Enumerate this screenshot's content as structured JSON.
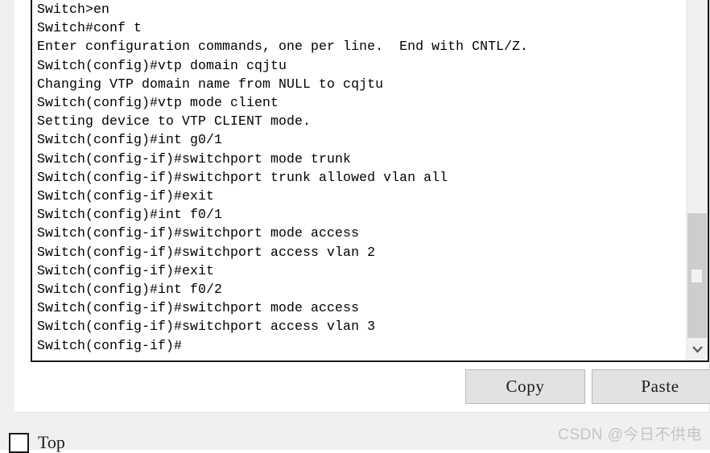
{
  "console": {
    "lines": [
      "Switch>en",
      "Switch#conf t",
      "Enter configuration commands, one per line.  End with CNTL/Z.",
      "Switch(config)#vtp domain cqjtu",
      "Changing VTP domain name from NULL to cqjtu",
      "Switch(config)#vtp mode client",
      "Setting device to VTP CLIENT mode.",
      "Switch(config)#int g0/1",
      "Switch(config-if)#switchport mode trunk",
      "Switch(config-if)#switchport trunk allowed vlan all",
      "Switch(config-if)#exit",
      "Switch(config)#int f0/1",
      "Switch(config-if)#switchport mode access",
      "Switch(config-if)#switchport access vlan 2",
      "Switch(config-if)#exit",
      "Switch(config)#int f0/2",
      "Switch(config-if)#switchport mode access",
      "Switch(config-if)#switchport access vlan 3",
      "Switch(config-if)#"
    ],
    "text_color": "#000000",
    "background_color": "#ffffff"
  },
  "scrollbar": {
    "down_arrow_icon": "chevron-down-icon",
    "thumb_color": "#cdcdcd",
    "track_color": "#f0f0f0"
  },
  "buttons": {
    "copy_label": "Copy",
    "paste_label": "Paste",
    "face_color": "#e2e2e2",
    "border_color": "#b9b9b9"
  },
  "options": {
    "top_checkbox_label": "Top",
    "top_checkbox_checked": false
  },
  "watermark": {
    "text": "CSDN @今日不供电",
    "color": "#c4c4c4"
  }
}
